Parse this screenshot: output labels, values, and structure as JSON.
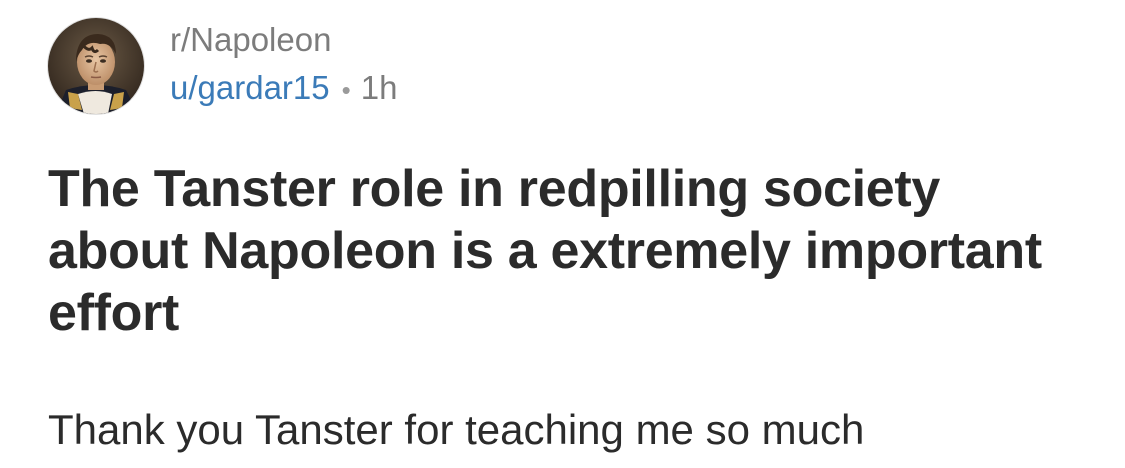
{
  "post": {
    "subreddit": "r/Napoleon",
    "author": "u/gardar15",
    "separator": "•",
    "age": "1h",
    "title": "The Tanster role in redpilling society about Napoleon is a extremely important effort",
    "body": "Thank you Tanster for teaching me so much"
  },
  "colors": {
    "subreddit": "#7c7c7c",
    "author": "#3b7bb8",
    "title": "#2b2b2b",
    "body": "#2b2b2b"
  },
  "icons": {
    "avatar": "subreddit-avatar-portrait"
  }
}
